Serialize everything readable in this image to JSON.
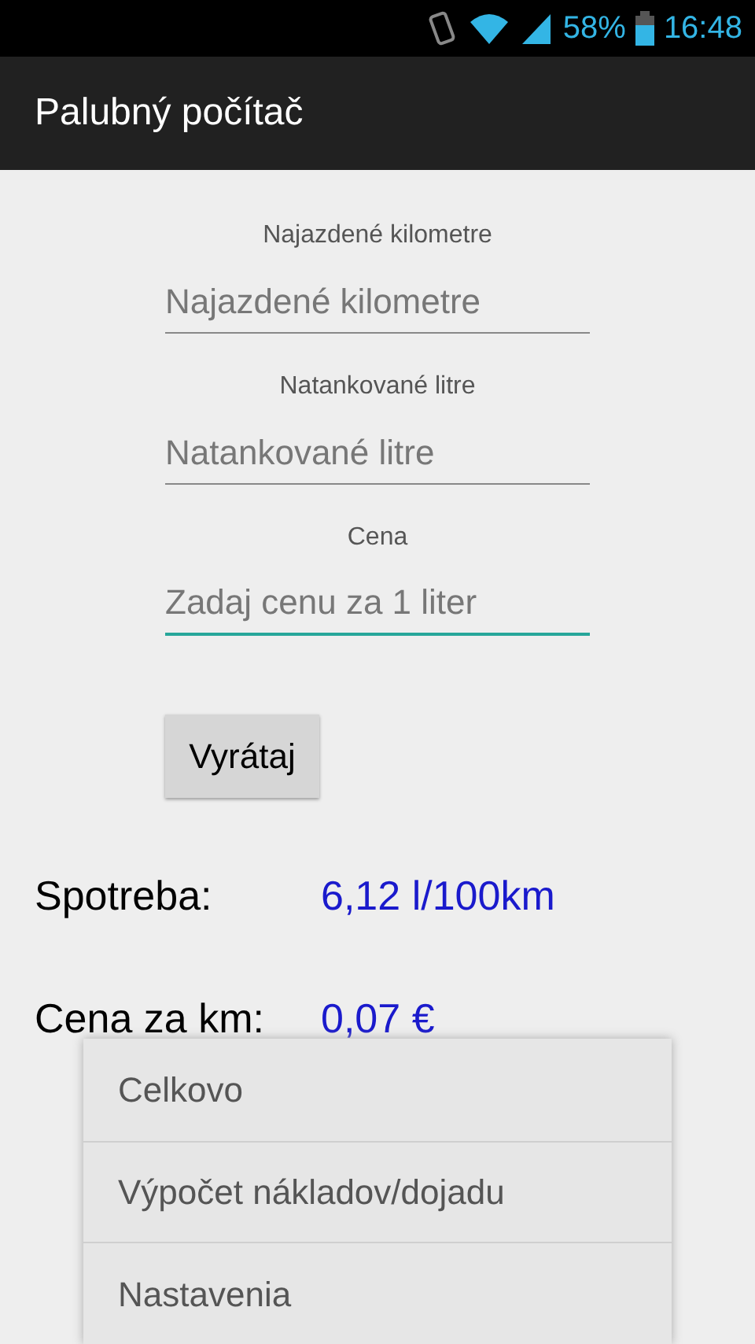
{
  "status_bar": {
    "battery": "58%",
    "time": "16:48"
  },
  "action_bar": {
    "title": "Palubný počítač"
  },
  "fields": [
    {
      "label": "Najazdené kilometre",
      "placeholder": "Najazdené kilometre",
      "focused": false
    },
    {
      "label": "Natankované litre",
      "placeholder": "Natankované litre",
      "focused": false
    },
    {
      "label": "Cena",
      "placeholder": "Zadaj cenu za 1 liter",
      "focused": true
    }
  ],
  "button": "Vyrátaj",
  "results": [
    {
      "label": "Spotreba:",
      "value": "6,12 l/100km"
    },
    {
      "label": "Cena za km:",
      "value": "0,07 €"
    }
  ],
  "menu": [
    "Celkovo",
    "Výpočet nákladov/dojadu",
    "Nastavenia"
  ]
}
